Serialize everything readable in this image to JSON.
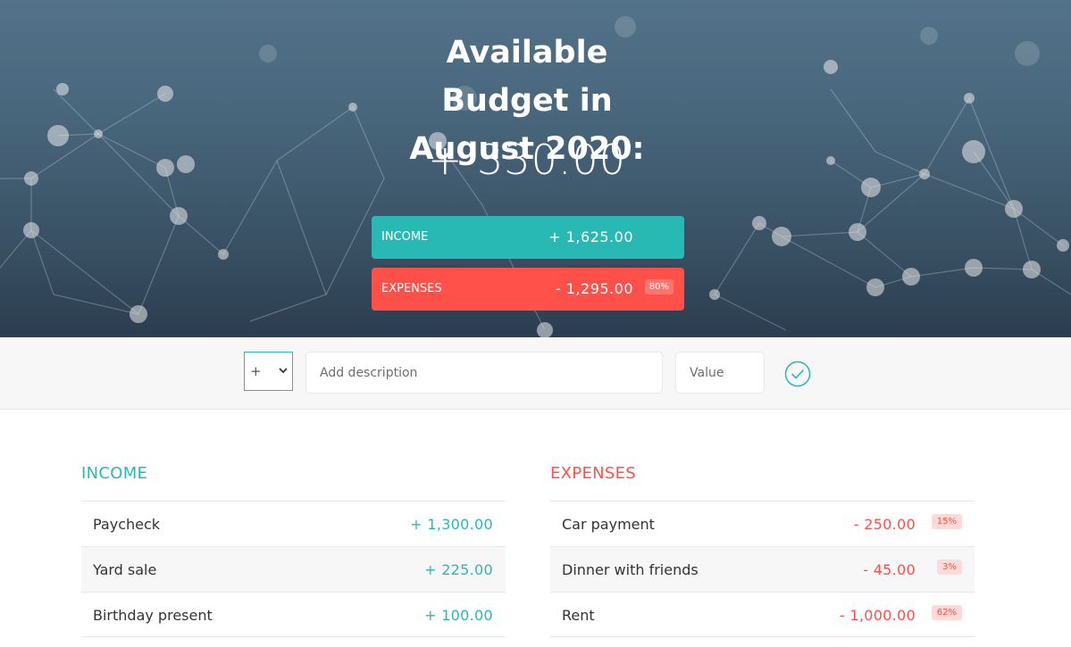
{
  "budget": {
    "title": "Available Budget in August 2020:",
    "value": "+ 330.00"
  },
  "summary": {
    "income": {
      "label": "INCOME",
      "value": "+ 1,625.00"
    },
    "expenses": {
      "label": "EXPENSES",
      "value": "- 1,295.00",
      "percentage": "80%"
    }
  },
  "add_form": {
    "type_value": "+",
    "description_placeholder": "Add description",
    "value_placeholder": "Value",
    "submit_icon": "checkmark-circle-icon"
  },
  "income": {
    "title": "Income",
    "items": [
      {
        "description": "Paycheck",
        "value": "+ 1,300.00"
      },
      {
        "description": "Yard sale",
        "value": "+ 225.00"
      },
      {
        "description": "Birthday present",
        "value": "+ 100.00"
      }
    ]
  },
  "expenses": {
    "title": "Expenses",
    "items": [
      {
        "description": "Car payment",
        "value": "- 250.00",
        "percentage": "15%"
      },
      {
        "description": "Dinner with friends",
        "value": "- 45.00",
        "percentage": "3%"
      },
      {
        "description": "Rent",
        "value": "- 1,000.00",
        "percentage": "62%"
      }
    ]
  },
  "colors": {
    "income": "#28b9b5",
    "expenses": "#ff5049"
  }
}
